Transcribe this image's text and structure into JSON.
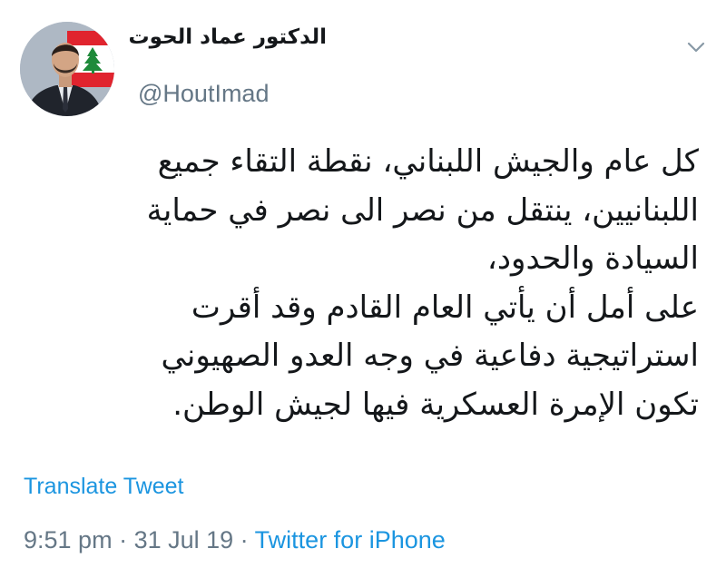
{
  "author": {
    "display_name": "الدكتور عماد الحوت",
    "handle": "@HoutImad",
    "avatar_icon": "profile-photo"
  },
  "menu": {
    "icon": "chevron-down-icon"
  },
  "tweet": {
    "lines": [
      "كل عام والجيش اللبناني، نقطة التقاء جميع",
      "اللبنانيين، ينتقل من نصر الى نصر في حماية",
      "السيادة والحدود،",
      "على أمل أن يأتي العام القادم وقد أقرت",
      "استراتيجية دفاعية في وجه العدو الصهيوني",
      "تكون الإمرة العسكرية فيها لجيش الوطن."
    ],
    "translate_label": "Translate Tweet"
  },
  "meta": {
    "time": "9:51 pm",
    "separator": " · ",
    "date": "31 Jul 19",
    "source": "Twitter for iPhone"
  },
  "colors": {
    "link": "#1b95e0",
    "secondary": "#657786",
    "text": "#14171a"
  }
}
